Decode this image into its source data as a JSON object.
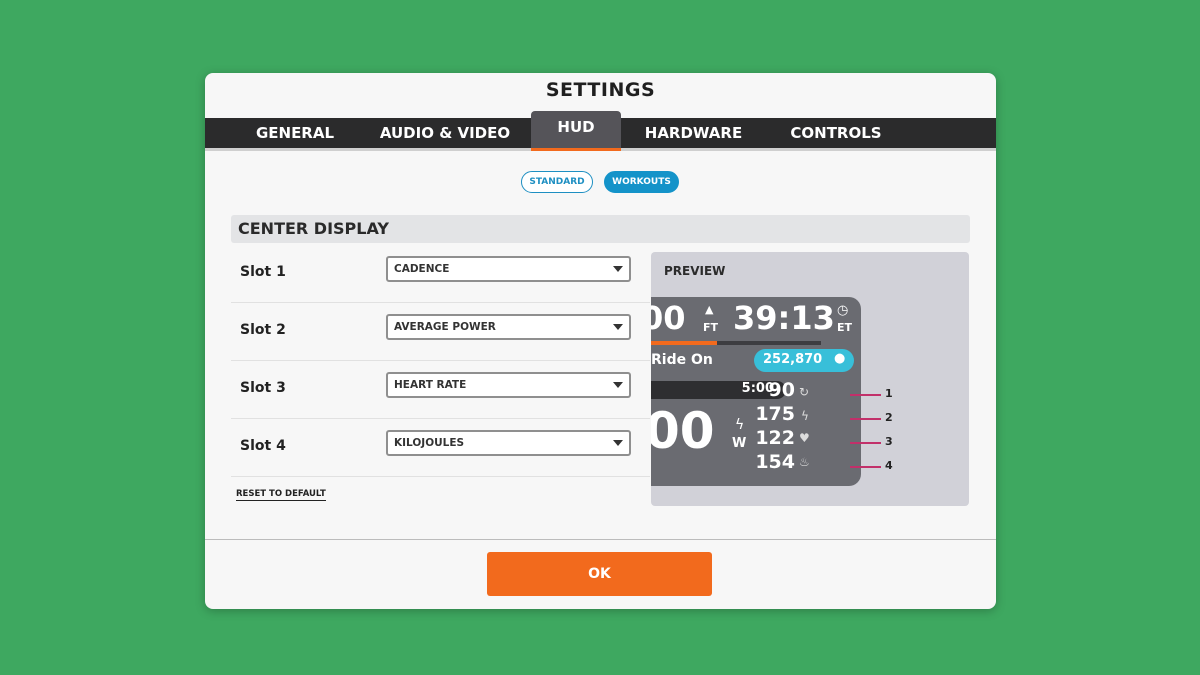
{
  "window": {
    "title": "SETTINGS"
  },
  "tabs": [
    {
      "label": "GENERAL",
      "active": false
    },
    {
      "label": "AUDIO & VIDEO",
      "active": false
    },
    {
      "label": "HUD",
      "active": true
    },
    {
      "label": "HARDWARE",
      "active": false
    },
    {
      "label": "CONTROLS",
      "active": false
    }
  ],
  "mode_toggle": {
    "standard_label": "STANDARD",
    "workouts_label": "WORKOUTS",
    "selected": "WORKOUTS"
  },
  "section": {
    "title": "CENTER DISPLAY"
  },
  "slots": [
    {
      "label": "Slot 1",
      "value": "CADENCE"
    },
    {
      "label": "Slot 2",
      "value": "AVERAGE POWER"
    },
    {
      "label": "Slot 3",
      "value": "HEART RATE"
    },
    {
      "label": "Slot 4",
      "value": "KILOJOULES"
    }
  ],
  "reset_label": "RESET TO DEFAULT",
  "preview": {
    "title": "PREVIEW",
    "elevation_partial": "00",
    "elevation_unit": "FT",
    "elapsed_time": "39:13",
    "time_unit": "ET",
    "ride_on_label": "Ride On",
    "drops": "252,870",
    "interval_timer": "5:00",
    "power_partial": "00",
    "power_unit": "W",
    "metrics": [
      {
        "value": "90",
        "icon": "cadence-icon",
        "slot": "1"
      },
      {
        "value": "175",
        "icon": "lightning-icon",
        "slot": "2"
      },
      {
        "value": "122",
        "icon": "heart-icon",
        "slot": "3"
      },
      {
        "value": "154",
        "icon": "flame-icon",
        "slot": "4"
      }
    ]
  },
  "ok_label": "OK",
  "colors": {
    "background": "#3ea860",
    "accent_orange": "#f26a1d",
    "accent_blue": "#1493c9",
    "drops_cyan": "#38bfd9",
    "slot_connector": "#c2306a"
  }
}
